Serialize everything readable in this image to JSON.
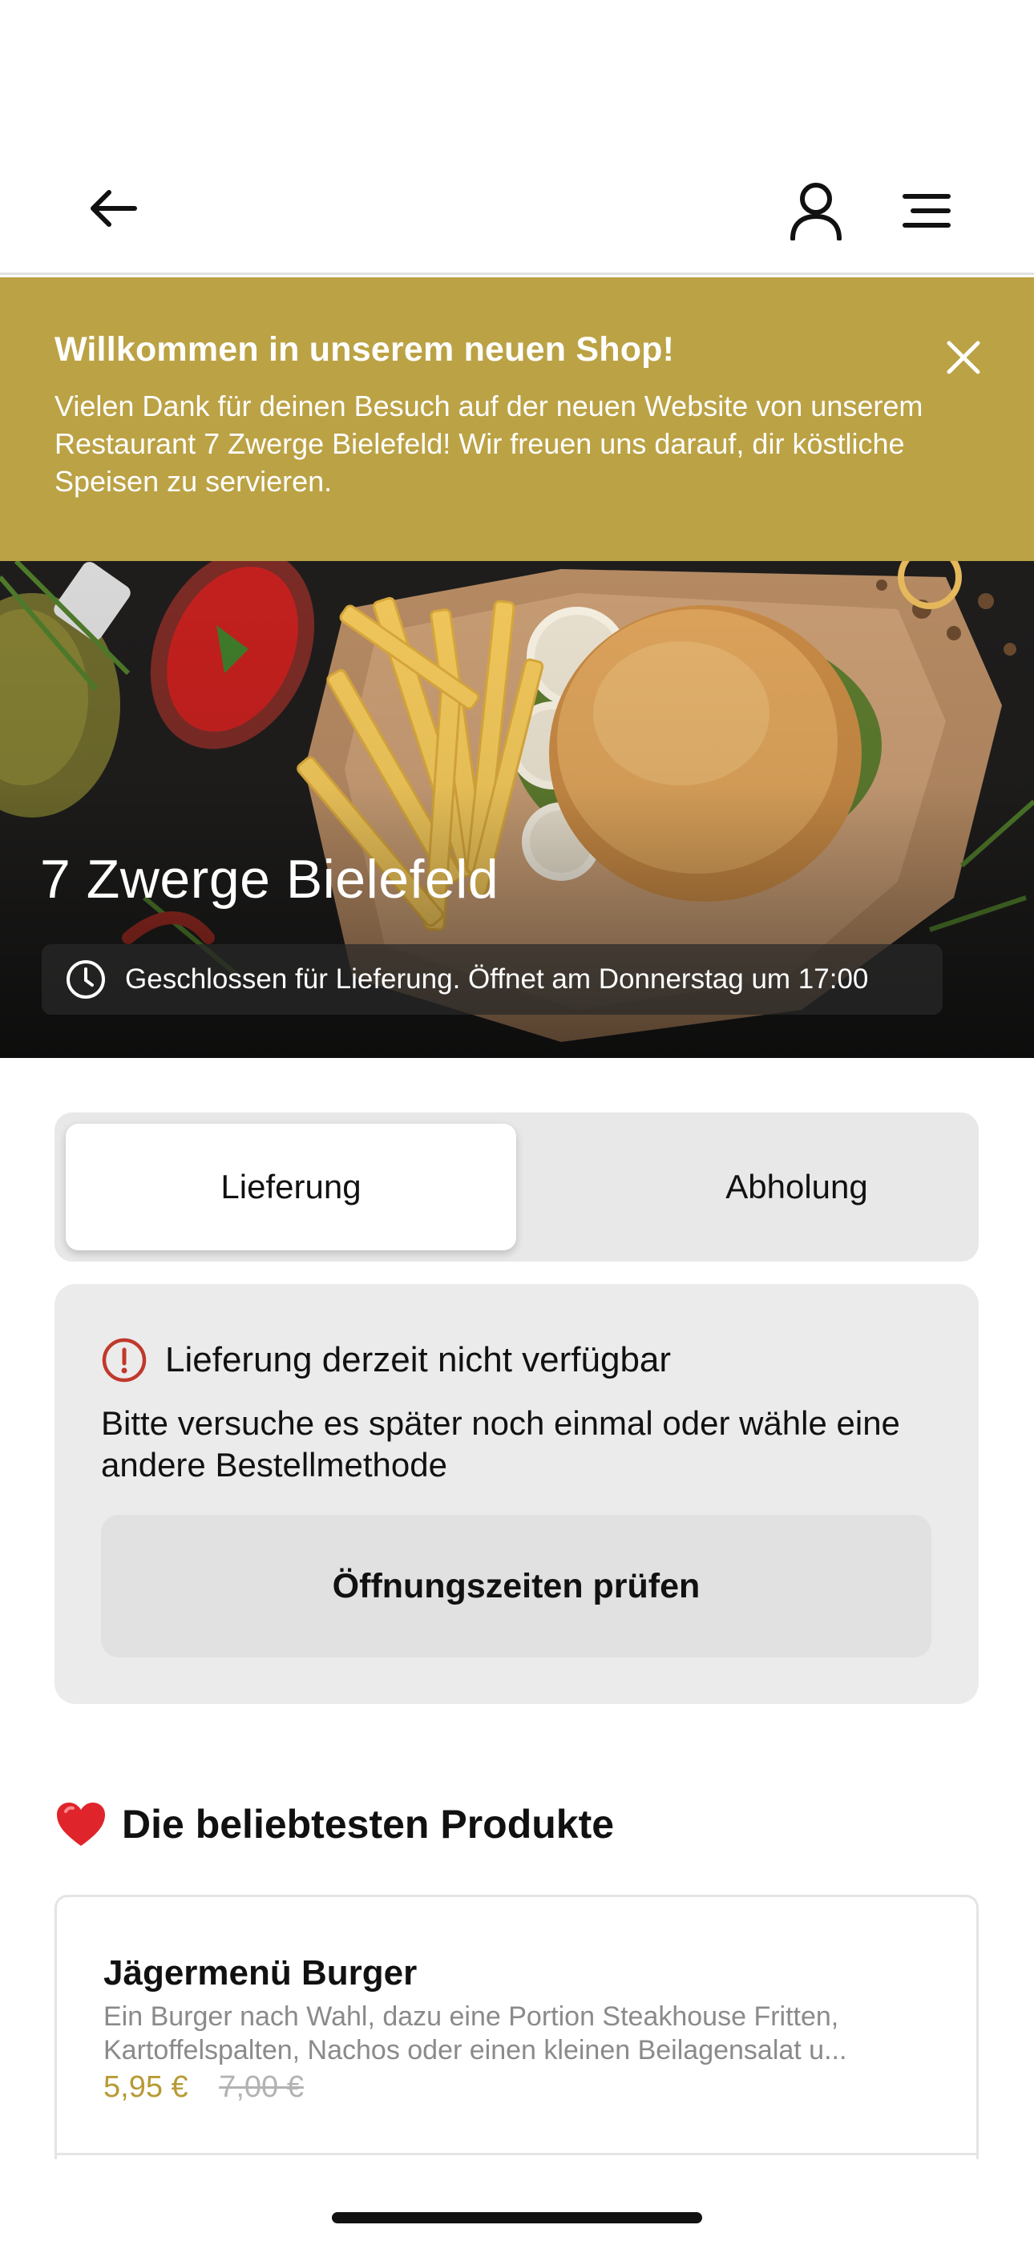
{
  "header": {
    "back_icon": "arrow-left-icon",
    "account_icon": "user-icon",
    "menu_icon": "menu-icon"
  },
  "banner": {
    "title": "Willkommen in unserem neuen Shop!",
    "text": "Vielen Dank für deinen Besuch auf der neuen Website von unserem Restaurant 7 Zwerge Bielefeld! Wir freuen uns darauf, dir köstliche Speisen zu servieren.",
    "close_icon": "close-icon",
    "background_color": "#bba245"
  },
  "hero": {
    "restaurant_name": "7 Zwerge Bielefeld",
    "status_text": "Geschlossen für Lieferung. Öffnet am Donnerstag um 17:00",
    "status_icon": "clock-icon"
  },
  "order_tabs": {
    "items": [
      {
        "label": "Lieferung",
        "active": true
      },
      {
        "label": "Abholung",
        "active": false
      }
    ]
  },
  "notice": {
    "icon": "info-icon",
    "title": "Lieferung derzeit nicht verfügbar",
    "text": "Bitte versuche es später noch einmal oder wähle eine andere Bestellmethode",
    "button_label": "Öffnungszeiten prüfen"
  },
  "popular": {
    "icon": "heart-icon",
    "title": "Die beliebtesten Produkte",
    "products": [
      {
        "name": "Jägermenü Burger",
        "description_line1": "Ein Burger nach Wahl, dazu eine Portion Steakhouse Fritten,",
        "description_line2": "Kartoffelspalten, Nachos oder einen kleinen Beilagensalat u...",
        "price": "5,95 €",
        "old_price": "7,00 €"
      }
    ]
  },
  "colors": {
    "accent": "#bba245",
    "price": "#b89a35",
    "error": "#c0392b"
  }
}
